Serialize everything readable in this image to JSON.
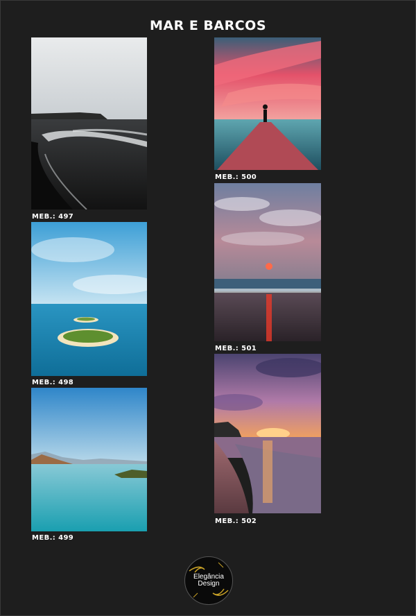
{
  "page": {
    "title": "MAR E BARCOS"
  },
  "items": [
    {
      "code": "MEB.: 497",
      "scene": "black-sand-beach"
    },
    {
      "code": "MEB.: 498",
      "scene": "tropical-island-aerial"
    },
    {
      "code": "MEB.: 499",
      "scene": "calm-blue-bay"
    },
    {
      "code": "MEB.: 500",
      "scene": "pier-sunset-silhouette"
    },
    {
      "code": "MEB.: 501",
      "scene": "cloudy-sunset-beach"
    },
    {
      "code": "MEB.: 502",
      "scene": "purple-sunset-shore"
    }
  ],
  "logo": {
    "line1": "Elegância",
    "line2": "Design"
  },
  "colors": {
    "background": "#1e1e1e",
    "text": "#ffffff",
    "logo_accent": "#c9a227"
  }
}
